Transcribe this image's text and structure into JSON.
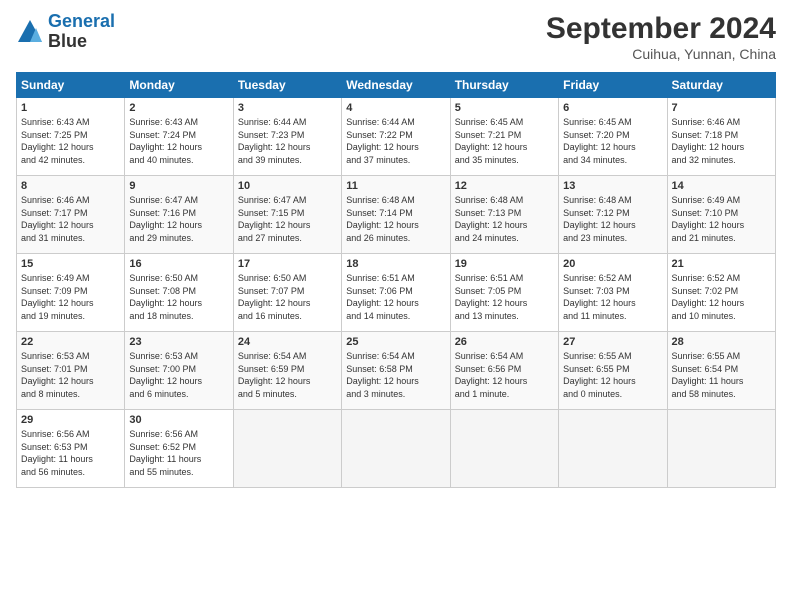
{
  "header": {
    "logo_line1": "General",
    "logo_line2": "Blue",
    "month": "September 2024",
    "location": "Cuihua, Yunnan, China"
  },
  "days_of_week": [
    "Sunday",
    "Monday",
    "Tuesday",
    "Wednesday",
    "Thursday",
    "Friday",
    "Saturday"
  ],
  "weeks": [
    [
      {
        "day": "1",
        "info": "Sunrise: 6:43 AM\nSunset: 7:25 PM\nDaylight: 12 hours\nand 42 minutes."
      },
      {
        "day": "2",
        "info": "Sunrise: 6:43 AM\nSunset: 7:24 PM\nDaylight: 12 hours\nand 40 minutes."
      },
      {
        "day": "3",
        "info": "Sunrise: 6:44 AM\nSunset: 7:23 PM\nDaylight: 12 hours\nand 39 minutes."
      },
      {
        "day": "4",
        "info": "Sunrise: 6:44 AM\nSunset: 7:22 PM\nDaylight: 12 hours\nand 37 minutes."
      },
      {
        "day": "5",
        "info": "Sunrise: 6:45 AM\nSunset: 7:21 PM\nDaylight: 12 hours\nand 35 minutes."
      },
      {
        "day": "6",
        "info": "Sunrise: 6:45 AM\nSunset: 7:20 PM\nDaylight: 12 hours\nand 34 minutes."
      },
      {
        "day": "7",
        "info": "Sunrise: 6:46 AM\nSunset: 7:18 PM\nDaylight: 12 hours\nand 32 minutes."
      }
    ],
    [
      {
        "day": "8",
        "info": "Sunrise: 6:46 AM\nSunset: 7:17 PM\nDaylight: 12 hours\nand 31 minutes."
      },
      {
        "day": "9",
        "info": "Sunrise: 6:47 AM\nSunset: 7:16 PM\nDaylight: 12 hours\nand 29 minutes."
      },
      {
        "day": "10",
        "info": "Sunrise: 6:47 AM\nSunset: 7:15 PM\nDaylight: 12 hours\nand 27 minutes."
      },
      {
        "day": "11",
        "info": "Sunrise: 6:48 AM\nSunset: 7:14 PM\nDaylight: 12 hours\nand 26 minutes."
      },
      {
        "day": "12",
        "info": "Sunrise: 6:48 AM\nSunset: 7:13 PM\nDaylight: 12 hours\nand 24 minutes."
      },
      {
        "day": "13",
        "info": "Sunrise: 6:48 AM\nSunset: 7:12 PM\nDaylight: 12 hours\nand 23 minutes."
      },
      {
        "day": "14",
        "info": "Sunrise: 6:49 AM\nSunset: 7:10 PM\nDaylight: 12 hours\nand 21 minutes."
      }
    ],
    [
      {
        "day": "15",
        "info": "Sunrise: 6:49 AM\nSunset: 7:09 PM\nDaylight: 12 hours\nand 19 minutes."
      },
      {
        "day": "16",
        "info": "Sunrise: 6:50 AM\nSunset: 7:08 PM\nDaylight: 12 hours\nand 18 minutes."
      },
      {
        "day": "17",
        "info": "Sunrise: 6:50 AM\nSunset: 7:07 PM\nDaylight: 12 hours\nand 16 minutes."
      },
      {
        "day": "18",
        "info": "Sunrise: 6:51 AM\nSunset: 7:06 PM\nDaylight: 12 hours\nand 14 minutes."
      },
      {
        "day": "19",
        "info": "Sunrise: 6:51 AM\nSunset: 7:05 PM\nDaylight: 12 hours\nand 13 minutes."
      },
      {
        "day": "20",
        "info": "Sunrise: 6:52 AM\nSunset: 7:03 PM\nDaylight: 12 hours\nand 11 minutes."
      },
      {
        "day": "21",
        "info": "Sunrise: 6:52 AM\nSunset: 7:02 PM\nDaylight: 12 hours\nand 10 minutes."
      }
    ],
    [
      {
        "day": "22",
        "info": "Sunrise: 6:53 AM\nSunset: 7:01 PM\nDaylight: 12 hours\nand 8 minutes."
      },
      {
        "day": "23",
        "info": "Sunrise: 6:53 AM\nSunset: 7:00 PM\nDaylight: 12 hours\nand 6 minutes."
      },
      {
        "day": "24",
        "info": "Sunrise: 6:54 AM\nSunset: 6:59 PM\nDaylight: 12 hours\nand 5 minutes."
      },
      {
        "day": "25",
        "info": "Sunrise: 6:54 AM\nSunset: 6:58 PM\nDaylight: 12 hours\nand 3 minutes."
      },
      {
        "day": "26",
        "info": "Sunrise: 6:54 AM\nSunset: 6:56 PM\nDaylight: 12 hours\nand 1 minute."
      },
      {
        "day": "27",
        "info": "Sunrise: 6:55 AM\nSunset: 6:55 PM\nDaylight: 12 hours\nand 0 minutes."
      },
      {
        "day": "28",
        "info": "Sunrise: 6:55 AM\nSunset: 6:54 PM\nDaylight: 11 hours\nand 58 minutes."
      }
    ],
    [
      {
        "day": "29",
        "info": "Sunrise: 6:56 AM\nSunset: 6:53 PM\nDaylight: 11 hours\nand 56 minutes."
      },
      {
        "day": "30",
        "info": "Sunrise: 6:56 AM\nSunset: 6:52 PM\nDaylight: 11 hours\nand 55 minutes."
      },
      {
        "day": "",
        "info": ""
      },
      {
        "day": "",
        "info": ""
      },
      {
        "day": "",
        "info": ""
      },
      {
        "day": "",
        "info": ""
      },
      {
        "day": "",
        "info": ""
      }
    ]
  ]
}
